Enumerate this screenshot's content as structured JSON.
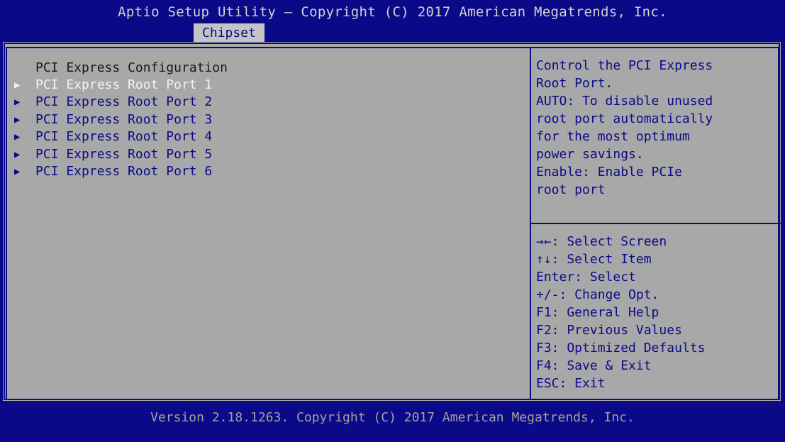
{
  "header": {
    "title": "Aptio Setup Utility – Copyright (C) 2017 American Megatrends, Inc.",
    "active_tab": "Chipset"
  },
  "main": {
    "section_title": "PCI Express Configuration",
    "items": [
      {
        "label": "PCI Express Root Port 1",
        "selected": true
      },
      {
        "label": "PCI Express Root Port 2",
        "selected": false
      },
      {
        "label": "PCI Express Root Port 3",
        "selected": false
      },
      {
        "label": "PCI Express Root Port 4",
        "selected": false
      },
      {
        "label": "PCI Express Root Port 5",
        "selected": false
      },
      {
        "label": "PCI Express Root Port 6",
        "selected": false
      }
    ],
    "item_arrow_icon": "submenu-arrow-icon"
  },
  "help": {
    "lines": [
      "Control the PCI Express",
      "Root Port.",
      "AUTO: To disable unused",
      "root port automatically",
      "for the most optimum",
      "power savings.",
      "Enable: Enable PCIe",
      "root port"
    ]
  },
  "keys": {
    "lines": [
      "→←: Select Screen",
      "↑↓: Select Item",
      "Enter: Select",
      "+/-: Change Opt.",
      "F1: General Help",
      "F2: Previous Values",
      "F3: Optimized Defaults",
      "F4: Save & Exit",
      "ESC: Exit"
    ]
  },
  "footer": {
    "version": "Version 2.18.1263. Copyright (C) 2017 American Megatrends, Inc."
  },
  "colors": {
    "background": "#0a0a88",
    "panel": "#a8a8a8",
    "text_blue": "#0a0a88",
    "selected_text": "#f2f2f2"
  }
}
